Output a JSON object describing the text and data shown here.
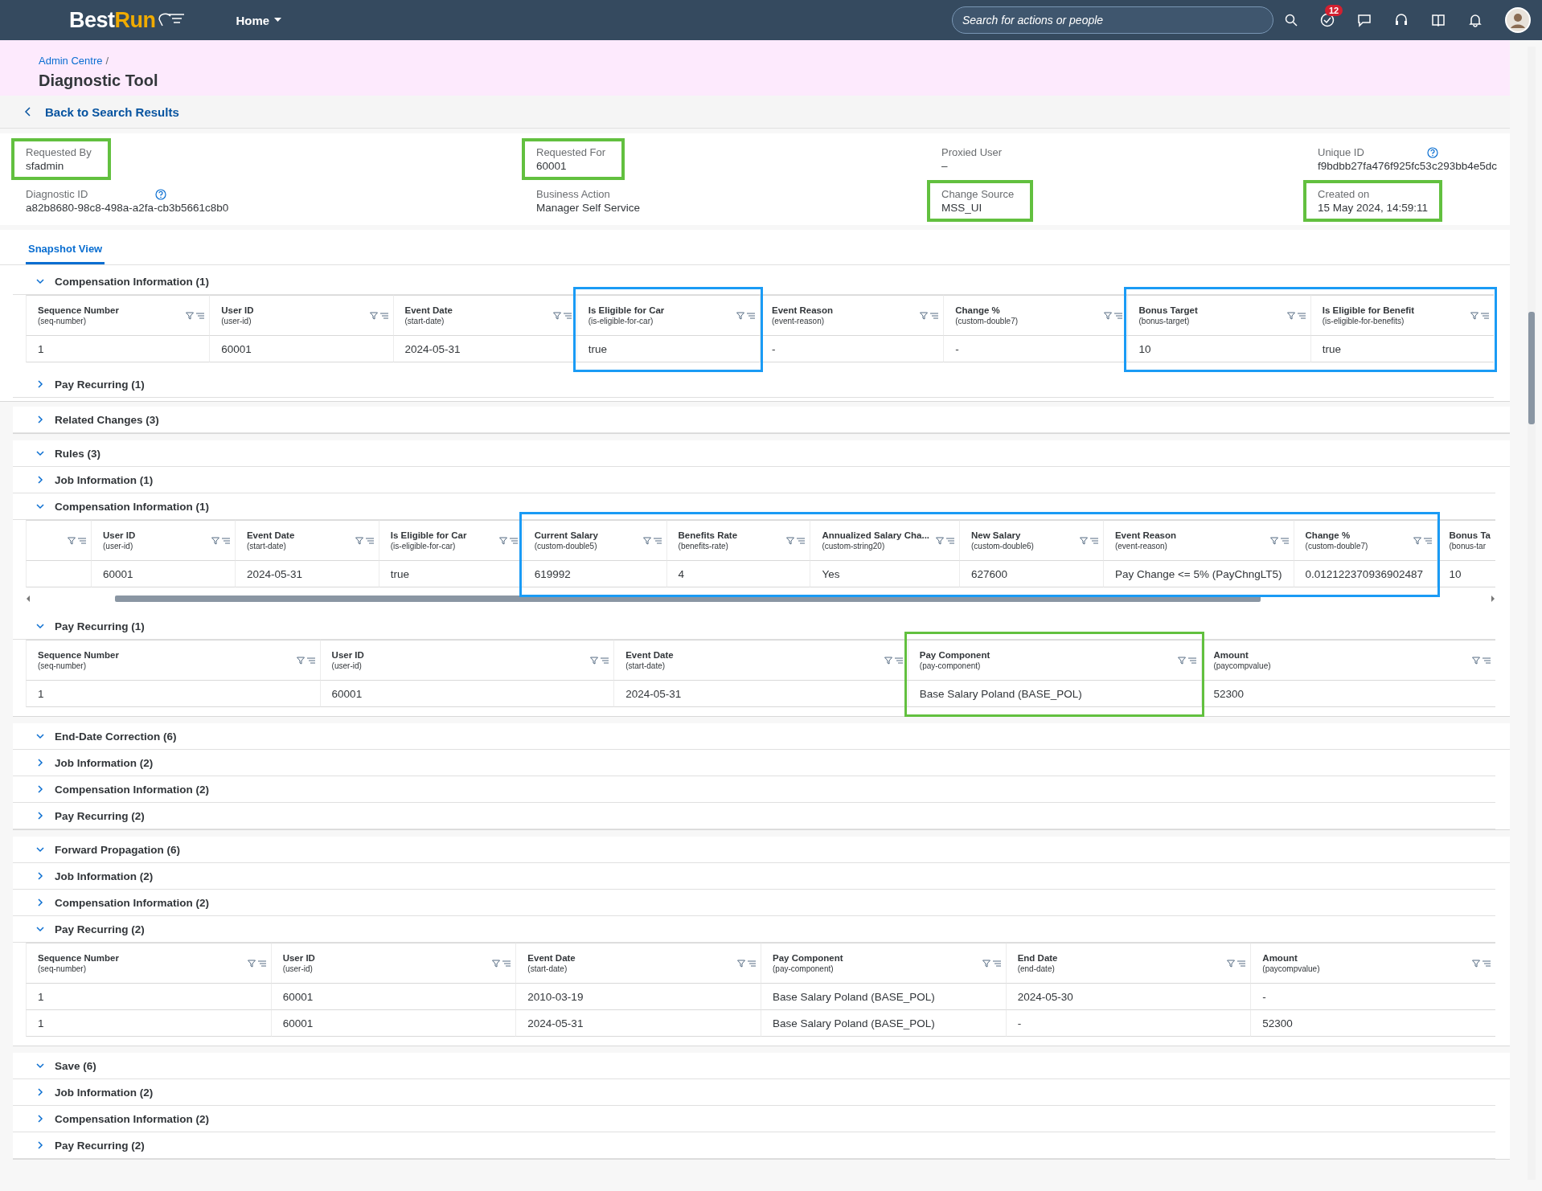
{
  "top_bar": {
    "logo": [
      "Best",
      "Run"
    ],
    "home_menu": "Home",
    "search_placeholder": "Search for actions or people",
    "task_badge": "12"
  },
  "page_header": {
    "breadcrumb": [
      {
        "label": "Admin Centre"
      }
    ],
    "breadcrumb_separator": "/",
    "title": "Diagnostic Tool",
    "back_link": "Back to Search Results"
  },
  "info_fields": [
    {
      "label": "Requested By",
      "value": "sfadmin",
      "help": false,
      "color": "#62c03f"
    },
    {
      "label": "Requested For",
      "value": "60001",
      "help": false,
      "color": "#62c03f"
    },
    {
      "label": "Proxied User",
      "value": "–",
      "help": false
    },
    {
      "label": "Unique ID",
      "value": "f9bdbb27fa476f925fc53c293bb4e5dc",
      "help": true
    },
    {
      "label": "Diagnostic ID",
      "value": "a82b8680-98c8-498a-a2fa-cb3b5661c8b0",
      "help": true
    },
    {
      "label": "Business Action",
      "value": "Manager Self Service",
      "help": false
    },
    {
      "label": "Change Source",
      "value": "MSS_UI",
      "help": false,
      "color": "#62c03f"
    },
    {
      "label": "Created on",
      "value": "15 May 2024, 14:59:11",
      "help": false,
      "color": "#62c03f"
    }
  ],
  "snapshot": {
    "tabs": [
      {
        "label": "Snapshot View",
        "selected": true
      }
    ],
    "sections": [
      {
        "title": "Compensation Information (1)",
        "expanded": true,
        "table": {
          "columns": [
            {
              "label": "Sequence Number",
              "key": "(seq-number)"
            },
            {
              "label": "User ID",
              "key": "(user-id)"
            },
            {
              "label": "Event Date",
              "key": "(start-date)"
            },
            {
              "label": "Is Eligible for Car",
              "key": "(is-eligible-for-car)",
              "color": "#1a9bf5"
            },
            {
              "label": "Event Reason",
              "key": "(event-reason)"
            },
            {
              "label": "Change %",
              "key": "(custom-double7)"
            },
            {
              "label": "Bonus Target",
              "key": "(bonus-target)",
              "color": "#1a9bf5"
            },
            {
              "label": "Is Eligible for Benefit",
              "key": "(is-eligible-for-benefits)",
              "color": "#1a9bf5"
            }
          ],
          "rows": [
            [
              "1",
              "60001",
              "2024-05-31",
              "true",
              "-",
              "-",
              "10",
              "true"
            ]
          ]
        }
      },
      {
        "title": "Pay Recurring (1)",
        "expanded": false
      }
    ]
  },
  "groups": [
    {
      "title": "Related Changes (3)",
      "expanded": false
    },
    {
      "title": "Rules (3)",
      "expanded": true,
      "children": [
        {
          "title": "Job Information (1)",
          "expanded": false
        },
        {
          "title": "Compensation Information (1)",
          "expanded": true,
          "table": {
            "blank_first_column": true,
            "horizontal_scroll": true,
            "columns": [
              {
                "label": "User ID",
                "key": "(user-id)"
              },
              {
                "label": "Event Date",
                "key": "(start-date)"
              },
              {
                "label": "Is Eligible for Car",
                "key": "(is-eligible-for-car)"
              },
              {
                "label": "Current Salary",
                "key": "(custom-double5)",
                "color": "#1a9bf5"
              },
              {
                "label": "Benefits Rate",
                "key": "(benefits-rate)",
                "color": "#1a9bf5"
              },
              {
                "label": "Annualized Salary Cha...",
                "key": "(custom-string20)",
                "color": "#1a9bf5"
              },
              {
                "label": "New Salary",
                "key": "(custom-double6)",
                "color": "#1a9bf5"
              },
              {
                "label": "Event Reason",
                "key": "(event-reason)",
                "color": "#1a9bf5"
              },
              {
                "label": "Change %",
                "key": "(custom-double7)",
                "color": "#1a9bf5"
              },
              {
                "label": "Bonus Ta",
                "key": "(bonus-tar",
                "truncated": true
              }
            ],
            "rows": [
              [
                "60001",
                "2024-05-31",
                "true",
                "619992",
                "4",
                "Yes",
                "627600",
                "Pay Change <= 5% (PayChngLT5)",
                "0.012122370936902487",
                "10"
              ]
            ]
          }
        },
        {
          "title": "Pay Recurring (1)",
          "expanded": true,
          "table": {
            "columns": [
              {
                "label": "Sequence Number",
                "key": "(seq-number)"
              },
              {
                "label": "User ID",
                "key": "(user-id)"
              },
              {
                "label": "Event Date",
                "key": "(start-date)"
              },
              {
                "label": "Pay Component",
                "key": "(pay-component)",
                "color": "#62c03f"
              },
              {
                "label": "Amount",
                "key": "(paycompvalue)"
              }
            ],
            "rows": [
              [
                "1",
                "60001",
                "2024-05-31",
                "Base Salary Poland (BASE_POL)",
                "52300"
              ]
            ]
          }
        }
      ]
    },
    {
      "title": "End-Date Correction (6)",
      "expanded": true,
      "children": [
        {
          "title": "Job Information (2)",
          "expanded": false
        },
        {
          "title": "Compensation Information (2)",
          "expanded": false
        },
        {
          "title": "Pay Recurring (2)",
          "expanded": false
        }
      ]
    },
    {
      "title": "Forward Propagation (6)",
      "expanded": true,
      "children": [
        {
          "title": "Job Information (2)",
          "expanded": false
        },
        {
          "title": "Compensation Information (2)",
          "expanded": false
        },
        {
          "title": "Pay Recurring (2)",
          "expanded": true,
          "table": {
            "columns": [
              {
                "label": "Sequence Number",
                "key": "(seq-number)"
              },
              {
                "label": "User ID",
                "key": "(user-id)"
              },
              {
                "label": "Event Date",
                "key": "(start-date)"
              },
              {
                "label": "Pay Component",
                "key": "(pay-component)"
              },
              {
                "label": "End Date",
                "key": "(end-date)"
              },
              {
                "label": "Amount",
                "key": "(paycompvalue)"
              }
            ],
            "rows": [
              [
                "1",
                "60001",
                "2010-03-19",
                "Base Salary Poland (BASE_POL)",
                "2024-05-30",
                "-"
              ],
              [
                "1",
                "60001",
                "2024-05-31",
                "Base Salary Poland (BASE_POL)",
                "-",
                "52300"
              ]
            ]
          }
        }
      ]
    },
    {
      "title": "Save (6)",
      "expanded": true,
      "children": [
        {
          "title": "Job Information (2)",
          "expanded": false
        },
        {
          "title": "Compensation Information (2)",
          "expanded": false
        },
        {
          "title": "Pay Recurring (2)",
          "expanded": false
        }
      ]
    }
  ]
}
